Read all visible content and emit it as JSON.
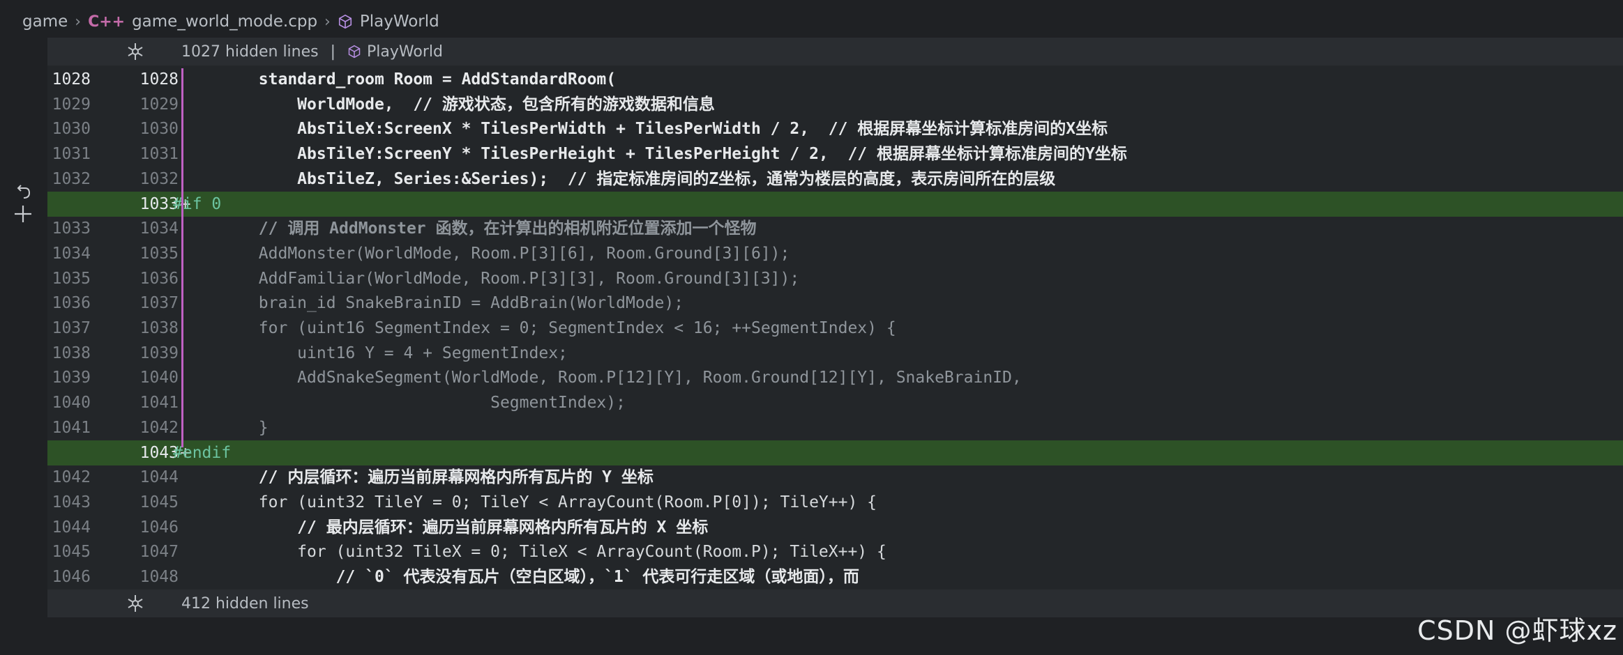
{
  "breadcrumb": {
    "root": "game",
    "file_icon_text": "C++",
    "file": "game_world_mode.cpp",
    "symbol": "PlayWorld"
  },
  "hidden_top": {
    "text": "1027 hidden lines",
    "separator": "|",
    "symbol": "PlayWorld"
  },
  "hidden_bottom": {
    "text": "412 hidden lines"
  },
  "lines": [
    {
      "old": "1028",
      "new": "1028",
      "code": "        standard_room Room = AddStandardRoom(",
      "style": "strong"
    },
    {
      "old": "1029",
      "new": "1029",
      "code": "            WorldMode,  // 游戏状态，包含所有的游戏数据和信息",
      "style": "cmt"
    },
    {
      "old": "1030",
      "new": "1030",
      "code": "            AbsTileX:ScreenX * TilesPerWidth + TilesPerWidth / 2,  // 根据屏幕坐标计算标准房间的X坐标",
      "style": "cmt"
    },
    {
      "old": "1031",
      "new": "1031",
      "code": "            AbsTileY:ScreenY * TilesPerHeight + TilesPerHeight / 2,  // 根据屏幕坐标计算标准房间的Y坐标",
      "style": "cmt"
    },
    {
      "old": "1032",
      "new": "1032",
      "code": "            AbsTileZ, Series:&Series);  // 指定标准房间的Z坐标，通常为楼层的高度，表示房间所在的层级",
      "style": "cmt"
    },
    {
      "old": "",
      "new": "1033",
      "code": "#if 0",
      "style": "pp",
      "added": true
    },
    {
      "old": "1033",
      "new": "1034",
      "code": "        // 调用 AddMonster 函数，在计算出的相机附近位置添加一个怪物",
      "style": "dimcmt"
    },
    {
      "old": "1034",
      "new": "1035",
      "code": "        AddMonster(WorldMode, Room.P[3][6], Room.Ground[3][6]);",
      "style": "dim"
    },
    {
      "old": "1035",
      "new": "1036",
      "code": "        AddFamiliar(WorldMode, Room.P[3][3], Room.Ground[3][3]);",
      "style": "dim"
    },
    {
      "old": "1036",
      "new": "1037",
      "code": "        brain_id SnakeBrainID = AddBrain(WorldMode);",
      "style": "dim"
    },
    {
      "old": "1037",
      "new": "1038",
      "code": "        for (uint16 SegmentIndex = 0; SegmentIndex < 16; ++SegmentIndex) {",
      "style": "dim"
    },
    {
      "old": "1038",
      "new": "1039",
      "code": "            uint16 Y = 4 + SegmentIndex;",
      "style": "dim"
    },
    {
      "old": "1039",
      "new": "1040",
      "code": "            AddSnakeSegment(WorldMode, Room.P[12][Y], Room.Ground[12][Y], SnakeBrainID,",
      "style": "dim"
    },
    {
      "old": "1040",
      "new": "1041",
      "code": "                                SegmentIndex);",
      "style": "dim"
    },
    {
      "old": "1041",
      "new": "1042",
      "code": "        }",
      "style": "dim"
    },
    {
      "old": "",
      "new": "1043",
      "code": "#endif",
      "style": "pp",
      "added": true
    },
    {
      "old": "1042",
      "new": "1044",
      "code": "        // 内层循环：遍历当前屏幕网格内所有瓦片的 Y 坐标",
      "style": "cmt"
    },
    {
      "old": "1043",
      "new": "1045",
      "code": "        for (uint32 TileY = 0; TileY < ArrayCount(Room.P[0]); TileY++) {",
      "style": "normal"
    },
    {
      "old": "1044",
      "new": "1046",
      "code": "            // 最内层循环：遍历当前屏幕网格内所有瓦片的 X 坐标",
      "style": "cmt"
    },
    {
      "old": "1045",
      "new": "1047",
      "code": "            for (uint32 TileX = 0; TileX < ArrayCount(Room.P); TileX++) {",
      "style": "normal"
    },
    {
      "old": "1046",
      "new": "1048",
      "code": "                // `0` 代表没有瓦片（空白区域），`1` 代表可行走区域（或地面），而",
      "style": "cmt"
    }
  ],
  "watermark": "CSDN @虾球xz",
  "colors": {
    "added_line": "#2d5226",
    "change_bar": "#c061c4",
    "background": "#232629"
  }
}
